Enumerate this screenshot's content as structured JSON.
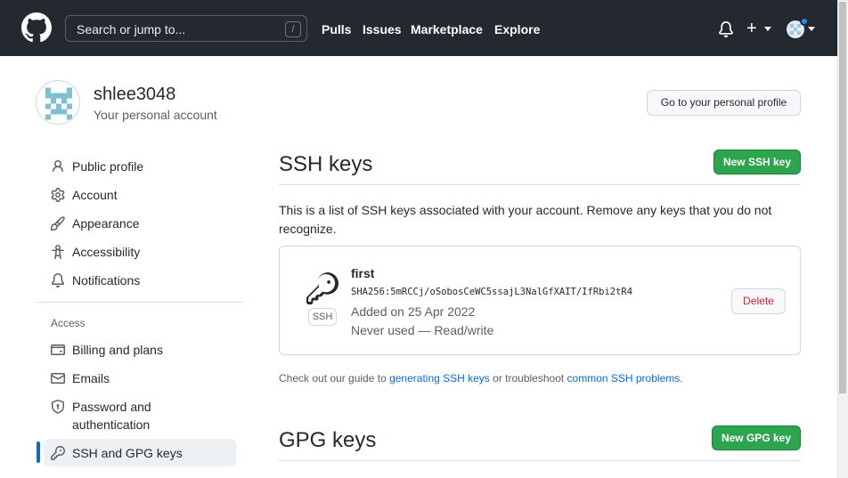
{
  "header": {
    "search_placeholder": "Search or jump to...",
    "search_shortcut": "/",
    "nav": [
      "Pulls",
      "Issues",
      "Marketplace",
      "Explore"
    ],
    "plus_label": "+"
  },
  "profile": {
    "username": "shlee3048",
    "subtitle": "Your personal account",
    "profile_button": "Go to your personal profile"
  },
  "sidebar": {
    "items": [
      {
        "label": "Public profile",
        "icon": "person-icon"
      },
      {
        "label": "Account",
        "icon": "gear-icon"
      },
      {
        "label": "Appearance",
        "icon": "paintbrush-icon"
      },
      {
        "label": "Accessibility",
        "icon": "accessibility-icon"
      },
      {
        "label": "Notifications",
        "icon": "bell-icon"
      }
    ],
    "access_heading": "Access",
    "access_items": [
      {
        "label": "Billing and plans",
        "icon": "credit-card-icon"
      },
      {
        "label": "Emails",
        "icon": "mail-icon"
      },
      {
        "label_line1": "Password and",
        "label_line2": "authentication",
        "icon": "shield-lock-icon"
      },
      {
        "label": "SSH and GPG keys",
        "icon": "key-icon",
        "selected": true
      }
    ]
  },
  "ssh": {
    "title": "SSH keys",
    "new_button": "New SSH key",
    "description": "This is a list of SSH keys associated with your account. Remove any keys that you do not recognize.",
    "key": {
      "title": "first",
      "fingerprint": "SHA256:5mRCCj/oSobosCeWC5ssajL3NalGfXAIT/IfRbi2tR4",
      "added": "Added on 25 Apr 2022",
      "usage": "Never used — Read/write",
      "type_label": "SSH",
      "delete_button": "Delete"
    },
    "help": {
      "prefix": "Check out our guide to ",
      "link1": "generating SSH keys",
      "middle": " or troubleshoot ",
      "link2": "common SSH problems",
      "suffix": "."
    }
  },
  "gpg": {
    "title": "GPG keys",
    "new_button": "New GPG key"
  },
  "colors": {
    "header_bg": "#24292f",
    "primary_green": "#2da44e",
    "link_blue": "#0969da",
    "danger_red": "#cf222e"
  }
}
